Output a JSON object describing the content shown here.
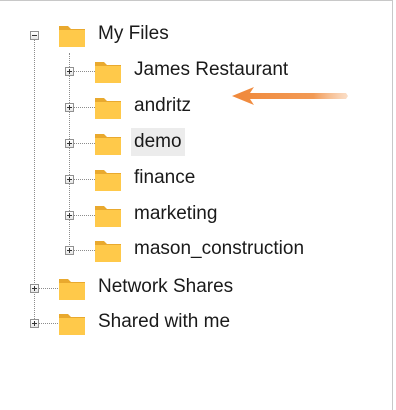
{
  "tree": {
    "root": {
      "label": "My Files",
      "expanded": true,
      "icon": "folder-icon",
      "children": [
        {
          "label": "James Restaurant",
          "expanded": false,
          "icon": "folder-icon"
        },
        {
          "label": "andritz",
          "expanded": false,
          "icon": "folder-icon"
        },
        {
          "label": "demo",
          "expanded": false,
          "icon": "folder-icon",
          "selected": true
        },
        {
          "label": "finance",
          "expanded": false,
          "icon": "folder-icon"
        },
        {
          "label": "marketing",
          "expanded": false,
          "icon": "folder-icon"
        },
        {
          "label": "mason_construction",
          "expanded": false,
          "icon": "folder-icon"
        }
      ]
    },
    "siblings": [
      {
        "label": "Network Shares",
        "expanded": false,
        "icon": "folder-icon"
      },
      {
        "label": "Shared with me",
        "expanded": false,
        "icon": "folder-icon"
      }
    ]
  },
  "annotation": {
    "icon": "orange-arrow-icon",
    "color": "#f0883a"
  },
  "colors": {
    "folder": "#ffc94a",
    "folder_dark": "#e9a92e",
    "selection": "#ececec"
  }
}
